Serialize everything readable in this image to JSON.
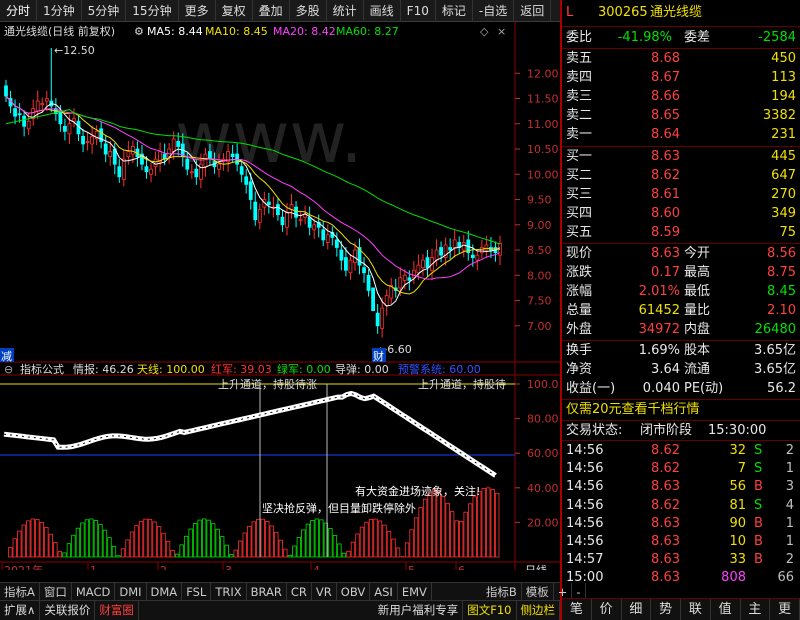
{
  "toolbar": {
    "items": [
      "分时",
      "1分钟",
      "5分钟",
      "15分钟",
      "更多",
      "复权",
      "叠加",
      "多股",
      "统计",
      "画线",
      "F10",
      "标记",
      "-自选",
      "返回"
    ]
  },
  "stock": {
    "flag": "L",
    "code": "300265",
    "name": "通光线缆"
  },
  "main_chart": {
    "legend_title": "通光线缆(日线 前复权)",
    "ma5": "MA5: 8.44",
    "ma10": "MA10: 8.45",
    "ma20": "MA20: 8.42",
    "ma60": "MA60: 8.27",
    "high_label": "12.50",
    "low_label": "6.60",
    "jian_label": "减",
    "cai_label": "财",
    "watermark": "www.",
    "y_ticks": [
      "12.00",
      "11.50",
      "11.00",
      "10.50",
      "10.00",
      "9.50",
      "9.00",
      "8.50",
      "8.00",
      "7.50",
      "7.00"
    ],
    "colors": {
      "ma5": "#ffffff",
      "ma10": "#f0e000",
      "ma20": "#ff40ff",
      "ma60": "#00e000",
      "up": "#ff3030",
      "down": "#00ffff"
    }
  },
  "indicator": {
    "title": "指标公式",
    "qingbao": "情报: 46.26",
    "tianxian": "天线: 100.00",
    "hongjun": "红军: 39.03",
    "lvjun": "绿军: 0.00",
    "daodan": "导弹: 0.00",
    "yujing": "预警系统: 60.00",
    "y_ticks": [
      "100.0",
      "80.00",
      "60.00",
      "40.00",
      "20.00"
    ],
    "ann1": "坚决抢反弹，但目量卸跌停除外",
    "ann2": "有大资金进场迹象，关注!",
    "ann3": "上升通道，持股待涨",
    "ann4": "上升通道，持股待"
  },
  "x_axis": {
    "labels": [
      "2021年",
      "1",
      "2",
      "3",
      "4",
      "5",
      "6"
    ],
    "right_label": "日线"
  },
  "tabs": [
    "指标A",
    "窗口",
    "MACD",
    "DMI",
    "DMA",
    "FSL",
    "TRIX",
    "BRAR",
    "CR",
    "VR",
    "OBV",
    "ASI",
    "EMV",
    "指标B",
    "模板",
    "+",
    "-"
  ],
  "bottombar": {
    "left": [
      "扩展∧",
      "关联报价",
      "财富圈"
    ],
    "right": [
      "新用户福利专享",
      "图文F10",
      "侧边栏"
    ]
  },
  "quote": {
    "weibi_label": "委比",
    "weibi": "-41.98%",
    "weicha_label": "委差",
    "weicha": "-2584",
    "sell": [
      {
        "label": "卖五",
        "price": "8.68",
        "vol": "450"
      },
      {
        "label": "卖四",
        "price": "8.67",
        "vol": "113"
      },
      {
        "label": "卖三",
        "price": "8.66",
        "vol": "194"
      },
      {
        "label": "卖二",
        "price": "8.65",
        "vol": "3382"
      },
      {
        "label": "卖一",
        "price": "8.64",
        "vol": "231"
      }
    ],
    "buy": [
      {
        "label": "买一",
        "price": "8.63",
        "vol": "445"
      },
      {
        "label": "买二",
        "price": "8.62",
        "vol": "647"
      },
      {
        "label": "买三",
        "price": "8.61",
        "vol": "270"
      },
      {
        "label": "买四",
        "price": "8.60",
        "vol": "349"
      },
      {
        "label": "买五",
        "price": "8.59",
        "vol": "75"
      }
    ],
    "stats": [
      {
        "l1": "现价",
        "v1": "8.63",
        "c1": "red",
        "l2": "今开",
        "v2": "8.56",
        "c2": "red"
      },
      {
        "l1": "涨跌",
        "v1": "0.17",
        "c1": "red",
        "l2": "最高",
        "v2": "8.75",
        "c2": "red"
      },
      {
        "l1": "涨幅",
        "v1": "2.01%",
        "c1": "red",
        "l2": "最低",
        "v2": "8.45",
        "c2": "green"
      },
      {
        "l1": "总量",
        "v1": "61452",
        "c1": "yellow",
        "l2": "量比",
        "v2": "2.10",
        "c2": "red"
      },
      {
        "l1": "外盘",
        "v1": "34972",
        "c1": "red",
        "l2": "内盘",
        "v2": "26480",
        "c2": "green"
      }
    ],
    "stats2": [
      {
        "l1": "换手",
        "v1": "1.69%",
        "l2": "股本",
        "v2": "3.65亿"
      },
      {
        "l1": "净资",
        "v1": "3.64",
        "l2": "流通",
        "v2": "3.65亿"
      },
      {
        "l1": "收益(一)",
        "v1": "0.040",
        "l2": "PE(动)",
        "v2": "56.2"
      }
    ],
    "promo": "仅需20元查看千档行情",
    "trade_state_label": "交易状态:",
    "trade_state": "闭市阶段",
    "trade_time": "15:30:00",
    "ticks": [
      {
        "t": "14:56",
        "p": "8.62",
        "v": "32",
        "f": "S",
        "n": "2",
        "fc": "green"
      },
      {
        "t": "14:56",
        "p": "8.62",
        "v": "7",
        "f": "S",
        "n": "1",
        "fc": "green"
      },
      {
        "t": "14:56",
        "p": "8.63",
        "v": "56",
        "f": "B",
        "n": "3",
        "fc": "red"
      },
      {
        "t": "14:56",
        "p": "8.62",
        "v": "81",
        "f": "S",
        "n": "4",
        "fc": "green"
      },
      {
        "t": "14:56",
        "p": "8.63",
        "v": "90",
        "f": "B",
        "n": "1",
        "fc": "red"
      },
      {
        "t": "14:56",
        "p": "8.63",
        "v": "10",
        "f": "B",
        "n": "1",
        "fc": "red"
      },
      {
        "t": "14:57",
        "p": "8.63",
        "v": "33",
        "f": "B",
        "n": "2",
        "fc": "red"
      },
      {
        "t": "15:00",
        "p": "8.63",
        "v": "808",
        "f": "",
        "n": "66",
        "fc": "red"
      }
    ],
    "tabs": [
      "笔",
      "价",
      "细",
      "势",
      "联",
      "值",
      "主",
      "更"
    ]
  }
}
